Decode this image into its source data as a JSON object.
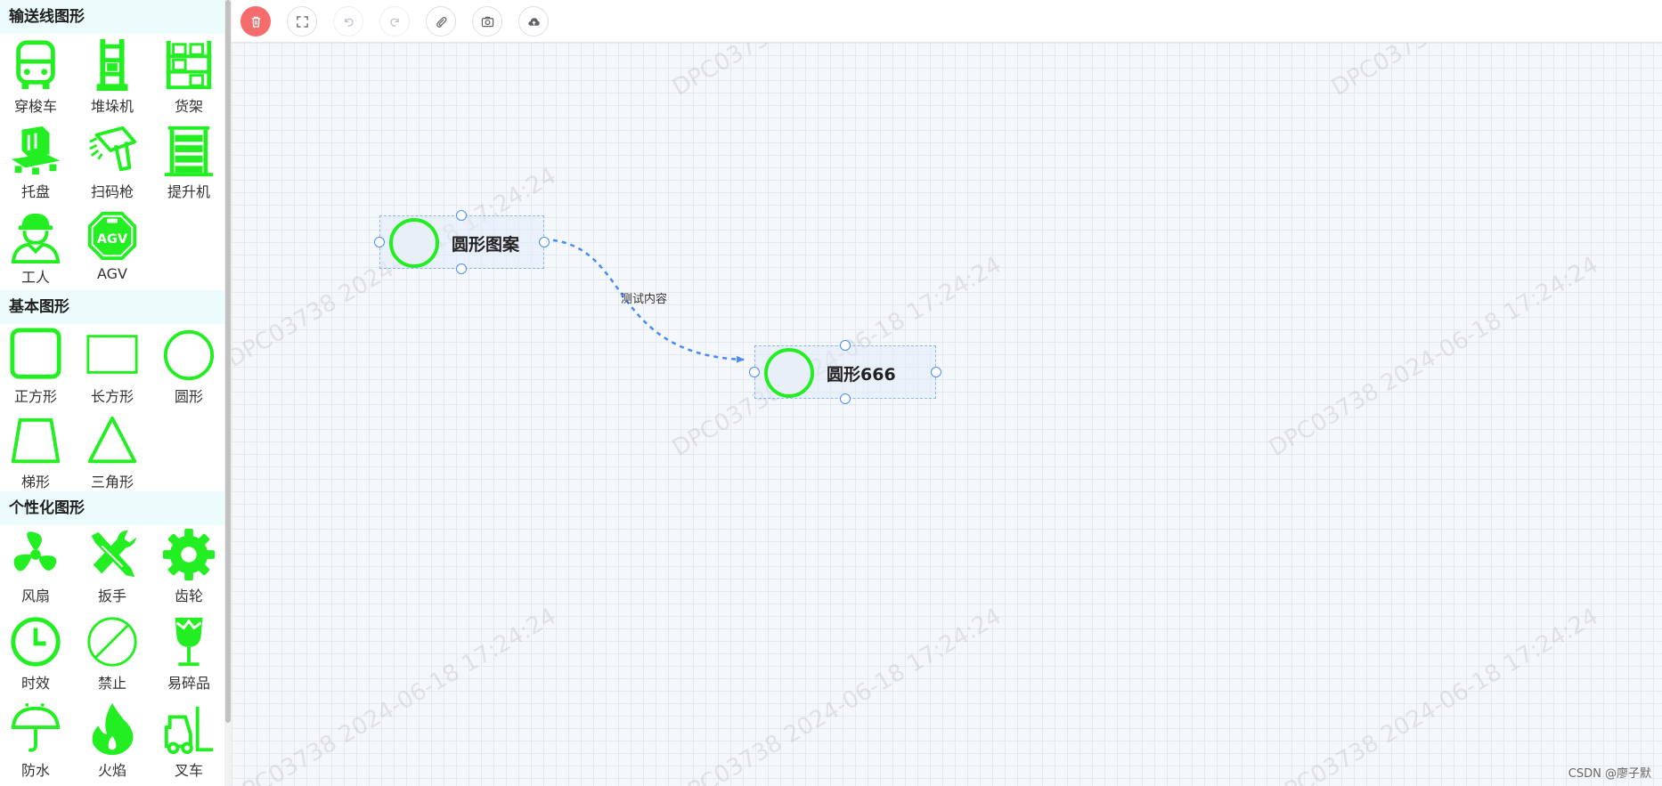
{
  "sidebar": {
    "categories": [
      {
        "title": "输送线图形",
        "items": [
          {
            "label": "穿梭车",
            "icon": "shuttle-car-icon"
          },
          {
            "label": "堆垛机",
            "icon": "stacker-crane-icon"
          },
          {
            "label": "货架",
            "icon": "shelf-icon"
          },
          {
            "label": "托盘",
            "icon": "pallet-icon"
          },
          {
            "label": "扫码枪",
            "icon": "barcode-scanner-icon"
          },
          {
            "label": "提升机",
            "icon": "hoist-icon"
          },
          {
            "label": "工人",
            "icon": "worker-icon"
          },
          {
            "label": "AGV",
            "icon": "agv-icon",
            "badge_top": "AGV"
          }
        ]
      },
      {
        "title": "基本图形",
        "items": [
          {
            "label": "正方形",
            "icon": "square-icon"
          },
          {
            "label": "长方形",
            "icon": "rectangle-icon"
          },
          {
            "label": "圆形",
            "icon": "circle-icon"
          },
          {
            "label": "梯形",
            "icon": "trapezoid-icon"
          },
          {
            "label": "三角形",
            "icon": "triangle-icon"
          }
        ]
      },
      {
        "title": "个性化图形",
        "items": [
          {
            "label": "风扇",
            "icon": "fan-icon"
          },
          {
            "label": "扳手",
            "icon": "wrench-icon"
          },
          {
            "label": "齿轮",
            "icon": "gear-icon"
          },
          {
            "label": "时效",
            "icon": "clock-icon"
          },
          {
            "label": "禁止",
            "icon": "forbidden-icon"
          },
          {
            "label": "易碎品",
            "icon": "fragile-icon"
          },
          {
            "label": "防水",
            "icon": "waterproof-icon"
          },
          {
            "label": "火焰",
            "icon": "flame-icon"
          },
          {
            "label": "叉车",
            "icon": "forklift-icon"
          }
        ]
      }
    ]
  },
  "toolbar": {
    "buttons": [
      {
        "name": "delete",
        "icon": "trash-icon",
        "state": "danger"
      },
      {
        "name": "fit-view",
        "icon": "fullscreen-icon",
        "state": "normal"
      },
      {
        "name": "undo",
        "icon": "undo-icon",
        "state": "disabled"
      },
      {
        "name": "redo",
        "icon": "redo-icon",
        "state": "disabled"
      },
      {
        "name": "attach",
        "icon": "paperclip-icon",
        "state": "normal"
      },
      {
        "name": "screenshot",
        "icon": "camera-icon",
        "state": "normal"
      },
      {
        "name": "upload",
        "icon": "cloud-upload-icon",
        "state": "normal"
      }
    ]
  },
  "canvas": {
    "nodes": [
      {
        "id": "node-1",
        "text": "圆形图案"
      },
      {
        "id": "node-2",
        "text": "圆形666"
      }
    ],
    "edges": [
      {
        "from": "node-1",
        "to": "node-2",
        "label": "测试内容"
      }
    ],
    "watermark_texts": [
      "DPC03738",
      "DPC03738  2024-06-18  17:24:24"
    ]
  },
  "credit": "CSDN @廖子默",
  "colors": {
    "icon_green": "#22ee22",
    "accent_blue": "#4a8cf5",
    "danger_red": "#f56c6c",
    "category_bg": "#ecfcfc",
    "grid_bg": "#f5f8fb"
  }
}
